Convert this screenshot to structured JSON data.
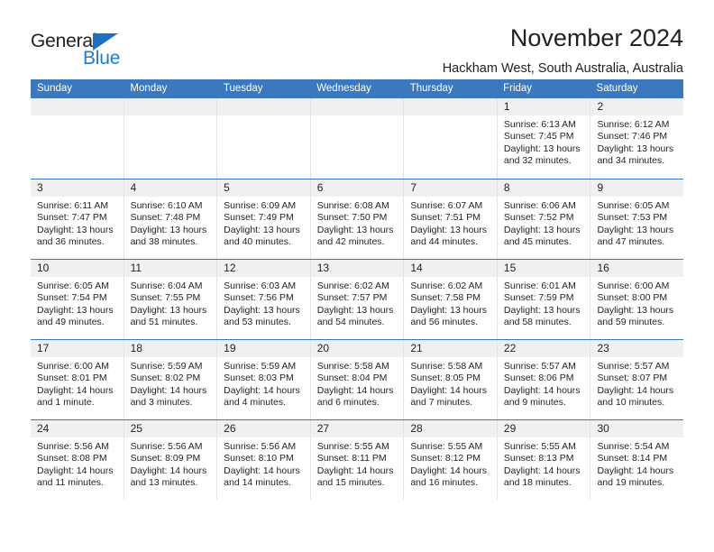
{
  "brand": {
    "name_part1": "General",
    "name_part2": "Blue",
    "color_dark": "#231f20",
    "color_blue": "#1b7cd6",
    "triangle_color": "#1f6fc0"
  },
  "header": {
    "title": "November 2024",
    "location": "Hackham West, South Australia, Australia"
  },
  "theme": {
    "header_row_bg": "#3b78bd",
    "header_row_text": "#ffffff",
    "daynum_band_bg": "#f0f0f0",
    "cell_bg": "#ffffff",
    "grid_line": "#e4e4e4"
  },
  "weekdays": [
    "Sunday",
    "Monday",
    "Tuesday",
    "Wednesday",
    "Thursday",
    "Friday",
    "Saturday"
  ],
  "weeks": [
    {
      "days": [
        {
          "num": "",
          "sunrise": "",
          "sunset": "",
          "daylight_line1": "",
          "daylight_line2": "",
          "empty": true
        },
        {
          "num": "",
          "sunrise": "",
          "sunset": "",
          "daylight_line1": "",
          "daylight_line2": "",
          "empty": true
        },
        {
          "num": "",
          "sunrise": "",
          "sunset": "",
          "daylight_line1": "",
          "daylight_line2": "",
          "empty": true
        },
        {
          "num": "",
          "sunrise": "",
          "sunset": "",
          "daylight_line1": "",
          "daylight_line2": "",
          "empty": true
        },
        {
          "num": "",
          "sunrise": "",
          "sunset": "",
          "daylight_line1": "",
          "daylight_line2": "",
          "empty": true
        },
        {
          "num": "1",
          "sunrise": "Sunrise: 6:13 AM",
          "sunset": "Sunset: 7:45 PM",
          "daylight_line1": "Daylight: 13 hours",
          "daylight_line2": "and 32 minutes.",
          "empty": false
        },
        {
          "num": "2",
          "sunrise": "Sunrise: 6:12 AM",
          "sunset": "Sunset: 7:46 PM",
          "daylight_line1": "Daylight: 13 hours",
          "daylight_line2": "and 34 minutes.",
          "empty": false
        }
      ]
    },
    {
      "days": [
        {
          "num": "3",
          "sunrise": "Sunrise: 6:11 AM",
          "sunset": "Sunset: 7:47 PM",
          "daylight_line1": "Daylight: 13 hours",
          "daylight_line2": "and 36 minutes.",
          "empty": false
        },
        {
          "num": "4",
          "sunrise": "Sunrise: 6:10 AM",
          "sunset": "Sunset: 7:48 PM",
          "daylight_line1": "Daylight: 13 hours",
          "daylight_line2": "and 38 minutes.",
          "empty": false
        },
        {
          "num": "5",
          "sunrise": "Sunrise: 6:09 AM",
          "sunset": "Sunset: 7:49 PM",
          "daylight_line1": "Daylight: 13 hours",
          "daylight_line2": "and 40 minutes.",
          "empty": false
        },
        {
          "num": "6",
          "sunrise": "Sunrise: 6:08 AM",
          "sunset": "Sunset: 7:50 PM",
          "daylight_line1": "Daylight: 13 hours",
          "daylight_line2": "and 42 minutes.",
          "empty": false
        },
        {
          "num": "7",
          "sunrise": "Sunrise: 6:07 AM",
          "sunset": "Sunset: 7:51 PM",
          "daylight_line1": "Daylight: 13 hours",
          "daylight_line2": "and 44 minutes.",
          "empty": false
        },
        {
          "num": "8",
          "sunrise": "Sunrise: 6:06 AM",
          "sunset": "Sunset: 7:52 PM",
          "daylight_line1": "Daylight: 13 hours",
          "daylight_line2": "and 45 minutes.",
          "empty": false
        },
        {
          "num": "9",
          "sunrise": "Sunrise: 6:05 AM",
          "sunset": "Sunset: 7:53 PM",
          "daylight_line1": "Daylight: 13 hours",
          "daylight_line2": "and 47 minutes.",
          "empty": false
        }
      ]
    },
    {
      "days": [
        {
          "num": "10",
          "sunrise": "Sunrise: 6:05 AM",
          "sunset": "Sunset: 7:54 PM",
          "daylight_line1": "Daylight: 13 hours",
          "daylight_line2": "and 49 minutes.",
          "empty": false
        },
        {
          "num": "11",
          "sunrise": "Sunrise: 6:04 AM",
          "sunset": "Sunset: 7:55 PM",
          "daylight_line1": "Daylight: 13 hours",
          "daylight_line2": "and 51 minutes.",
          "empty": false
        },
        {
          "num": "12",
          "sunrise": "Sunrise: 6:03 AM",
          "sunset": "Sunset: 7:56 PM",
          "daylight_line1": "Daylight: 13 hours",
          "daylight_line2": "and 53 minutes.",
          "empty": false
        },
        {
          "num": "13",
          "sunrise": "Sunrise: 6:02 AM",
          "sunset": "Sunset: 7:57 PM",
          "daylight_line1": "Daylight: 13 hours",
          "daylight_line2": "and 54 minutes.",
          "empty": false
        },
        {
          "num": "14",
          "sunrise": "Sunrise: 6:02 AM",
          "sunset": "Sunset: 7:58 PM",
          "daylight_line1": "Daylight: 13 hours",
          "daylight_line2": "and 56 minutes.",
          "empty": false
        },
        {
          "num": "15",
          "sunrise": "Sunrise: 6:01 AM",
          "sunset": "Sunset: 7:59 PM",
          "daylight_line1": "Daylight: 13 hours",
          "daylight_line2": "and 58 minutes.",
          "empty": false
        },
        {
          "num": "16",
          "sunrise": "Sunrise: 6:00 AM",
          "sunset": "Sunset: 8:00 PM",
          "daylight_line1": "Daylight: 13 hours",
          "daylight_line2": "and 59 minutes.",
          "empty": false
        }
      ]
    },
    {
      "days": [
        {
          "num": "17",
          "sunrise": "Sunrise: 6:00 AM",
          "sunset": "Sunset: 8:01 PM",
          "daylight_line1": "Daylight: 14 hours",
          "daylight_line2": "and 1 minute.",
          "empty": false
        },
        {
          "num": "18",
          "sunrise": "Sunrise: 5:59 AM",
          "sunset": "Sunset: 8:02 PM",
          "daylight_line1": "Daylight: 14 hours",
          "daylight_line2": "and 3 minutes.",
          "empty": false
        },
        {
          "num": "19",
          "sunrise": "Sunrise: 5:59 AM",
          "sunset": "Sunset: 8:03 PM",
          "daylight_line1": "Daylight: 14 hours",
          "daylight_line2": "and 4 minutes.",
          "empty": false
        },
        {
          "num": "20",
          "sunrise": "Sunrise: 5:58 AM",
          "sunset": "Sunset: 8:04 PM",
          "daylight_line1": "Daylight: 14 hours",
          "daylight_line2": "and 6 minutes.",
          "empty": false
        },
        {
          "num": "21",
          "sunrise": "Sunrise: 5:58 AM",
          "sunset": "Sunset: 8:05 PM",
          "daylight_line1": "Daylight: 14 hours",
          "daylight_line2": "and 7 minutes.",
          "empty": false
        },
        {
          "num": "22",
          "sunrise": "Sunrise: 5:57 AM",
          "sunset": "Sunset: 8:06 PM",
          "daylight_line1": "Daylight: 14 hours",
          "daylight_line2": "and 9 minutes.",
          "empty": false
        },
        {
          "num": "23",
          "sunrise": "Sunrise: 5:57 AM",
          "sunset": "Sunset: 8:07 PM",
          "daylight_line1": "Daylight: 14 hours",
          "daylight_line2": "and 10 minutes.",
          "empty": false
        }
      ]
    },
    {
      "days": [
        {
          "num": "24",
          "sunrise": "Sunrise: 5:56 AM",
          "sunset": "Sunset: 8:08 PM",
          "daylight_line1": "Daylight: 14 hours",
          "daylight_line2": "and 11 minutes.",
          "empty": false
        },
        {
          "num": "25",
          "sunrise": "Sunrise: 5:56 AM",
          "sunset": "Sunset: 8:09 PM",
          "daylight_line1": "Daylight: 14 hours",
          "daylight_line2": "and 13 minutes.",
          "empty": false
        },
        {
          "num": "26",
          "sunrise": "Sunrise: 5:56 AM",
          "sunset": "Sunset: 8:10 PM",
          "daylight_line1": "Daylight: 14 hours",
          "daylight_line2": "and 14 minutes.",
          "empty": false
        },
        {
          "num": "27",
          "sunrise": "Sunrise: 5:55 AM",
          "sunset": "Sunset: 8:11 PM",
          "daylight_line1": "Daylight: 14 hours",
          "daylight_line2": "and 15 minutes.",
          "empty": false
        },
        {
          "num": "28",
          "sunrise": "Sunrise: 5:55 AM",
          "sunset": "Sunset: 8:12 PM",
          "daylight_line1": "Daylight: 14 hours",
          "daylight_line2": "and 16 minutes.",
          "empty": false
        },
        {
          "num": "29",
          "sunrise": "Sunrise: 5:55 AM",
          "sunset": "Sunset: 8:13 PM",
          "daylight_line1": "Daylight: 14 hours",
          "daylight_line2": "and 18 minutes.",
          "empty": false
        },
        {
          "num": "30",
          "sunrise": "Sunrise: 5:54 AM",
          "sunset": "Sunset: 8:14 PM",
          "daylight_line1": "Daylight: 14 hours",
          "daylight_line2": "and 19 minutes.",
          "empty": false
        }
      ]
    }
  ]
}
